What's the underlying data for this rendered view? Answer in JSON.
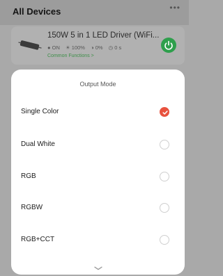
{
  "header": {
    "title": "All Devices",
    "more_icon": "•••"
  },
  "device": {
    "name": "150W 5 in 1 LED Driver (WiFi...",
    "status_on": "ON",
    "status_brightness": "100%",
    "status_cct": "0%",
    "status_timer": "0 s",
    "link": "Common Functions >",
    "power_color": "#2e9f4c"
  },
  "sheet": {
    "title": "Output Mode",
    "selected_color": "#e8523e",
    "options": [
      {
        "label": "Single Color",
        "selected": true
      },
      {
        "label": "Dual White",
        "selected": false
      },
      {
        "label": "RGB",
        "selected": false
      },
      {
        "label": "RGBW",
        "selected": false
      },
      {
        "label": "RGB+CCT",
        "selected": false
      }
    ]
  }
}
